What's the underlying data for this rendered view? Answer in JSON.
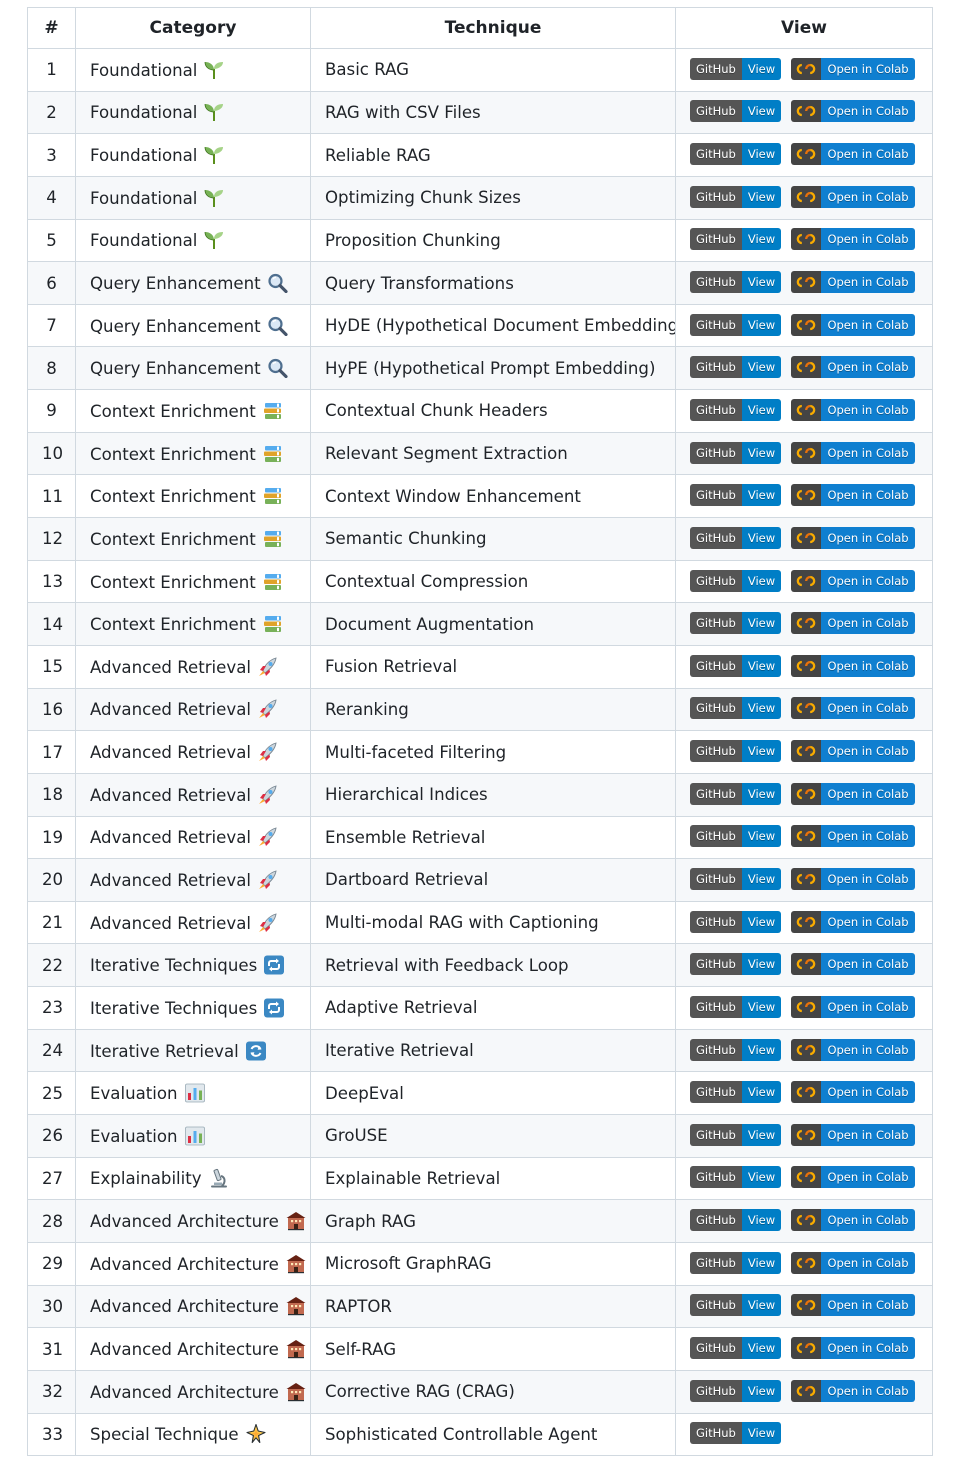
{
  "table": {
    "headers": [
      "#",
      "Category",
      "Technique",
      "View"
    ],
    "rows": [
      {
        "num": "1",
        "category": "Foundational",
        "icon": "seedling-icon",
        "technique": "Basic RAG",
        "colab": true
      },
      {
        "num": "2",
        "category": "Foundational",
        "icon": "seedling-icon",
        "technique": "RAG with CSV Files",
        "colab": true
      },
      {
        "num": "3",
        "category": "Foundational",
        "icon": "seedling-icon",
        "technique": "Reliable RAG",
        "colab": true
      },
      {
        "num": "4",
        "category": "Foundational",
        "icon": "seedling-icon",
        "technique": "Optimizing Chunk Sizes",
        "colab": true
      },
      {
        "num": "5",
        "category": "Foundational",
        "icon": "seedling-icon",
        "technique": "Proposition Chunking",
        "colab": true
      },
      {
        "num": "6",
        "category": "Query Enhancement",
        "icon": "magnifier-icon",
        "technique": "Query Transformations",
        "colab": true
      },
      {
        "num": "7",
        "category": "Query Enhancement",
        "icon": "magnifier-icon",
        "technique": "HyDE (Hypothetical Document Embedding)",
        "colab": true
      },
      {
        "num": "8",
        "category": "Query Enhancement",
        "icon": "magnifier-icon",
        "technique": "HyPE (Hypothetical Prompt Embedding)",
        "colab": true
      },
      {
        "num": "9",
        "category": "Context Enrichment",
        "icon": "books-icon",
        "technique": "Contextual Chunk Headers",
        "colab": true
      },
      {
        "num": "10",
        "category": "Context Enrichment",
        "icon": "books-icon",
        "technique": "Relevant Segment Extraction",
        "colab": true
      },
      {
        "num": "11",
        "category": "Context Enrichment",
        "icon": "books-icon",
        "technique": "Context Window Enhancement",
        "colab": true
      },
      {
        "num": "12",
        "category": "Context Enrichment",
        "icon": "books-icon",
        "technique": "Semantic Chunking",
        "colab": true
      },
      {
        "num": "13",
        "category": "Context Enrichment",
        "icon": "books-icon",
        "technique": "Contextual Compression",
        "colab": true
      },
      {
        "num": "14",
        "category": "Context Enrichment",
        "icon": "books-icon",
        "technique": "Document Augmentation",
        "colab": true
      },
      {
        "num": "15",
        "category": "Advanced Retrieval",
        "icon": "rocket-icon",
        "technique": "Fusion Retrieval",
        "colab": true
      },
      {
        "num": "16",
        "category": "Advanced Retrieval",
        "icon": "rocket-icon",
        "technique": "Reranking",
        "colab": true
      },
      {
        "num": "17",
        "category": "Advanced Retrieval",
        "icon": "rocket-icon",
        "technique": "Multi-faceted Filtering",
        "colab": true
      },
      {
        "num": "18",
        "category": "Advanced Retrieval",
        "icon": "rocket-icon",
        "technique": "Hierarchical Indices",
        "colab": true
      },
      {
        "num": "19",
        "category": "Advanced Retrieval",
        "icon": "rocket-icon",
        "technique": "Ensemble Retrieval",
        "colab": true
      },
      {
        "num": "20",
        "category": "Advanced Retrieval",
        "icon": "rocket-icon",
        "technique": "Dartboard Retrieval",
        "colab": true
      },
      {
        "num": "21",
        "category": "Advanced Retrieval",
        "icon": "rocket-icon",
        "technique": "Multi-modal RAG with Captioning",
        "colab": true
      },
      {
        "num": "22",
        "category": "Iterative Techniques",
        "icon": "arrows-loop-icon",
        "technique": "Retrieval with Feedback Loop",
        "colab": true
      },
      {
        "num": "23",
        "category": "Iterative Techniques",
        "icon": "arrows-loop-icon",
        "technique": "Adaptive Retrieval",
        "colab": true
      },
      {
        "num": "24",
        "category": "Iterative Retrieval",
        "icon": "refresh-icon",
        "technique": "Iterative Retrieval",
        "colab": true
      },
      {
        "num": "25",
        "category": "Evaluation",
        "icon": "bar-chart-icon",
        "technique": "DeepEval",
        "colab": true
      },
      {
        "num": "26",
        "category": "Evaluation",
        "icon": "bar-chart-icon",
        "technique": "GroUSE",
        "colab": true
      },
      {
        "num": "27",
        "category": "Explainability",
        "icon": "microscope-icon",
        "technique": "Explainable Retrieval",
        "colab": true
      },
      {
        "num": "28",
        "category": "Advanced Architecture",
        "icon": "building-icon",
        "technique": "Graph RAG",
        "colab": true
      },
      {
        "num": "29",
        "category": "Advanced Architecture",
        "icon": "building-icon",
        "technique": "Microsoft GraphRAG",
        "colab": true
      },
      {
        "num": "30",
        "category": "Advanced Architecture",
        "icon": "building-icon",
        "technique": "RAPTOR",
        "colab": true
      },
      {
        "num": "31",
        "category": "Advanced Architecture",
        "icon": "building-icon",
        "technique": "Self-RAG",
        "colab": true
      },
      {
        "num": "32",
        "category": "Advanced Architecture",
        "icon": "building-icon",
        "technique": "Corrective RAG (CRAG)",
        "colab": true
      },
      {
        "num": "33",
        "category": "Special Technique",
        "icon": "sparkle-icon",
        "technique": "Sophisticated Controllable Agent",
        "colab": false
      }
    ]
  },
  "badges": {
    "github_label": "GitHub",
    "github_value": "View",
    "colab_value": "Open in Colab"
  },
  "colors": {
    "badge_left": "#555555",
    "badge_right": "#007ec6",
    "colab_orange": "#f9ab00",
    "border": "#d1d9e0",
    "stripe": "#f6f8fa"
  }
}
